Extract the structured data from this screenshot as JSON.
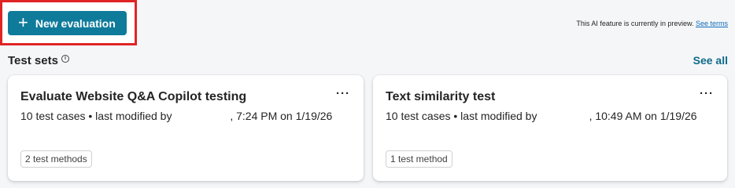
{
  "toolbar": {
    "new_evaluation_label": "New evaluation",
    "plus_icon": "+"
  },
  "preview": {
    "text": "This AI feature is currently in preview.",
    "link": "See terms"
  },
  "section": {
    "title": "Test sets",
    "info_icon": "i",
    "see_all": "See all"
  },
  "cards": [
    {
      "title": "Evaluate Website Q&A Copilot testing",
      "subtitle": "10 test cases • last modified by                   , 7:24 PM on 1/19/26",
      "more": "···",
      "badge": "2 test methods"
    },
    {
      "title": "Text similarity test",
      "subtitle": "10 test cases • last modified by                 , 10:49 AM on 1/19/26",
      "more": "···",
      "badge": "1 test method"
    }
  ],
  "colors": {
    "accent": "#0f7b9b",
    "highlight": "#e02424",
    "link": "#0f6cbd"
  }
}
